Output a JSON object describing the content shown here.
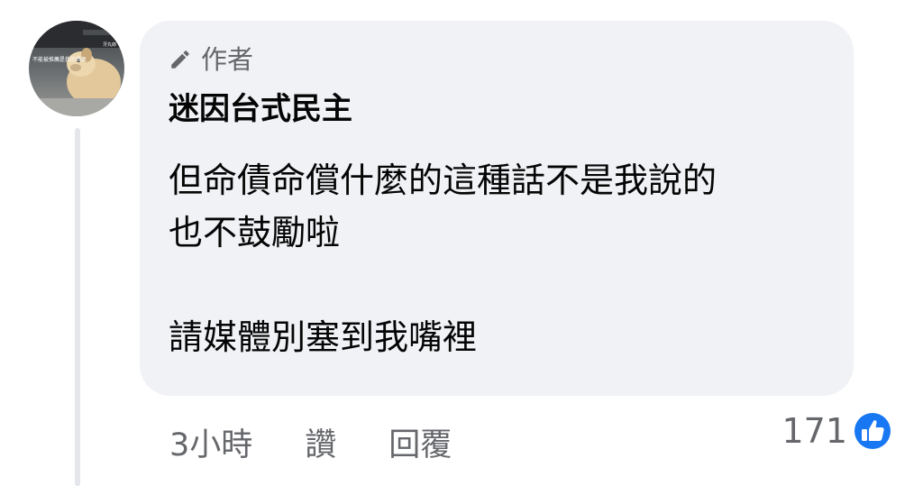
{
  "comment": {
    "author_badge": "作者",
    "commenter_name": "迷因台式民主",
    "body_lines": [
      "但命債命償什麼的這種話不是我說的",
      "也不鼓勵啦",
      "",
      "請媒體別塞到我嘴裡"
    ],
    "avatar_caption": "不能被推薦是我的福氣",
    "avatar_corner_text": "牙丸郎"
  },
  "actions": {
    "timestamp": "3小時",
    "like_label": "讚",
    "reply_label": "回覆"
  },
  "reactions": {
    "count": "171",
    "icon": "like-thumbs-up-icon",
    "icon_color": "#1877f2"
  },
  "colors": {
    "bubble_bg": "#f0f2f5",
    "secondary_text": "#65676b",
    "primary_text": "#050505",
    "thread_line": "#e4e6eb"
  }
}
